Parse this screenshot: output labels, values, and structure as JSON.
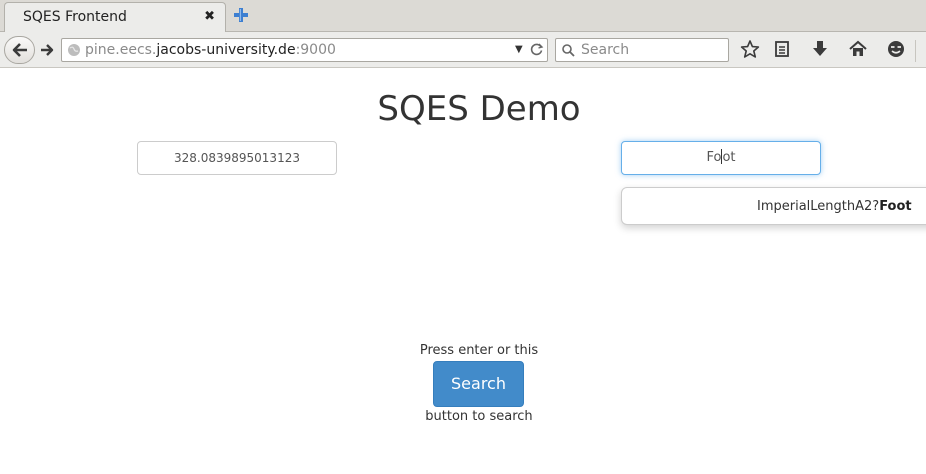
{
  "browser": {
    "tab_title": "SQES Frontend",
    "tab_close": "✖",
    "url_prefix": "pine.eecs.",
    "url_domain": "jacobs-university.de",
    "url_suffix": ":9000",
    "search_placeholder": "Search",
    "icons": [
      "back-arrow-icon",
      "forward-arrow-icon",
      "globe-icon",
      "dropdown-icon",
      "reload-icon",
      "search-icon",
      "star-icon",
      "reading-list-icon",
      "download-icon",
      "home-icon",
      "smiley-icon",
      "new-tab-icon"
    ]
  },
  "page": {
    "title": "SQES Demo",
    "value_input": "328.0839895013123",
    "unit_input_before_caret": "Fo",
    "unit_input_after_caret": "ot",
    "suggestion_prefix": "ImperialLengthA2?",
    "suggestion_match": "Foot",
    "press_text": "Press enter or this",
    "search_button": "Search",
    "button_text": "button to search"
  },
  "colors": {
    "button_blue": "#428bca",
    "focus_blue": "#66afe9",
    "chrome_gray": "#ececea"
  }
}
